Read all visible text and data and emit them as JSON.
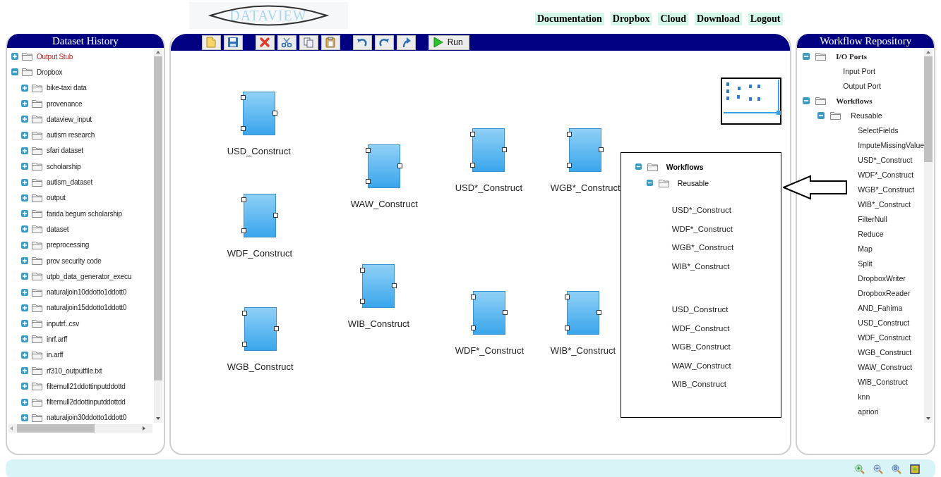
{
  "header": {
    "logo": "DATAVIEW",
    "nav": [
      "Documentation",
      "Dropbox",
      "Cloud",
      "Download",
      "Logout"
    ]
  },
  "dataset_history": {
    "title": "Dataset History",
    "tree": [
      {
        "label": "Output Stub",
        "kind": "output",
        "expanded": false
      },
      {
        "label": "Dropbox",
        "kind": "folder",
        "expanded": true,
        "children": [
          {
            "label": "bike-taxi data",
            "expanded": false
          },
          {
            "label": "provenance",
            "expanded": false
          },
          {
            "label": "dataview_input",
            "expanded": false
          },
          {
            "label": "autism research",
            "expanded": false
          },
          {
            "label": "sfari dataset",
            "expanded": false
          },
          {
            "label": "scholarship",
            "expanded": false
          },
          {
            "label": "autism_dataset",
            "expanded": false
          },
          {
            "label": "output",
            "expanded": false
          },
          {
            "label": "farida begum scholarship",
            "expanded": false
          },
          {
            "label": "dataset",
            "expanded": false
          },
          {
            "label": "preprocessing",
            "expanded": false
          },
          {
            "label": "prov security code",
            "expanded": false
          },
          {
            "label": "utpb_data_generator_execu",
            "expanded": false
          },
          {
            "label": "naturaljoin10ddotto1ddott0",
            "expanded": false
          },
          {
            "label": "naturaljoin15ddotto1ddott0",
            "expanded": false
          },
          {
            "label": "inputrf..csv",
            "expanded": false
          },
          {
            "label": "inrf.arff",
            "expanded": false
          },
          {
            "label": "in.arff",
            "expanded": false
          },
          {
            "label": "rf310_outputfile.txt",
            "expanded": false
          },
          {
            "label": "filternull21ddottinputddottd",
            "expanded": false
          },
          {
            "label": "filternull2ddottinputddottdd",
            "expanded": false
          },
          {
            "label": "naturaljoin30ddotto1ddott0",
            "expanded": false
          }
        ]
      }
    ]
  },
  "toolbar": {
    "run_label": "Run"
  },
  "canvas": {
    "nodes": [
      {
        "label": "USD_Construct"
      },
      {
        "label": "WDF_Construct"
      },
      {
        "label": "WGB_Construct"
      },
      {
        "label": "WAW_Construct"
      },
      {
        "label": "WIB_Construct"
      },
      {
        "label": "USD*_Construct"
      },
      {
        "label": "WGB*_Construct"
      },
      {
        "label": "WDF*_Construct"
      },
      {
        "label": "WIB*_Construct"
      }
    ]
  },
  "callout": {
    "tree": [
      {
        "label": "Workflows",
        "expanded": true,
        "children": [
          {
            "label": "Reusable",
            "expanded": true
          }
        ]
      }
    ],
    "groups": [
      [
        "USD*_Construct",
        "WDF*_Construct",
        "WGB*_Construct",
        "WIB*_Construct"
      ],
      [
        "USD_Construct",
        "WDF_Construct",
        "WGB_Construct",
        "WAW_Construct",
        "WIB_Construct"
      ]
    ]
  },
  "workflow_repository": {
    "title": "Workflow Repository",
    "tree": [
      {
        "label": "I/O Ports",
        "expanded": true,
        "children": [
          {
            "label": "Input Port"
          },
          {
            "label": "Output Port"
          }
        ]
      },
      {
        "label": "Workflows",
        "expanded": true,
        "children": [
          {
            "label": "Reusable",
            "expanded": true,
            "children": [
              {
                "label": "SelectFields"
              },
              {
                "label": "ImputeMissingValue"
              },
              {
                "label": "USD*_Construct"
              },
              {
                "label": "WDF*_Construct"
              },
              {
                "label": "WGB*_Construct"
              },
              {
                "label": "WIB*_Construct"
              },
              {
                "label": "FilterNull"
              },
              {
                "label": "Reduce"
              },
              {
                "label": "Map"
              },
              {
                "label": "Split"
              },
              {
                "label": "DropboxWriter"
              },
              {
                "label": "DropboxReader"
              },
              {
                "label": "AND_Fahima"
              },
              {
                "label": "USD_Construct"
              },
              {
                "label": "WDF_Construct"
              },
              {
                "label": "WGB_Construct"
              },
              {
                "label": "WAW_Construct"
              },
              {
                "label": "WIB_Construct"
              },
              {
                "label": "knn"
              },
              {
                "label": "apriori"
              }
            ]
          }
        ]
      }
    ]
  }
}
